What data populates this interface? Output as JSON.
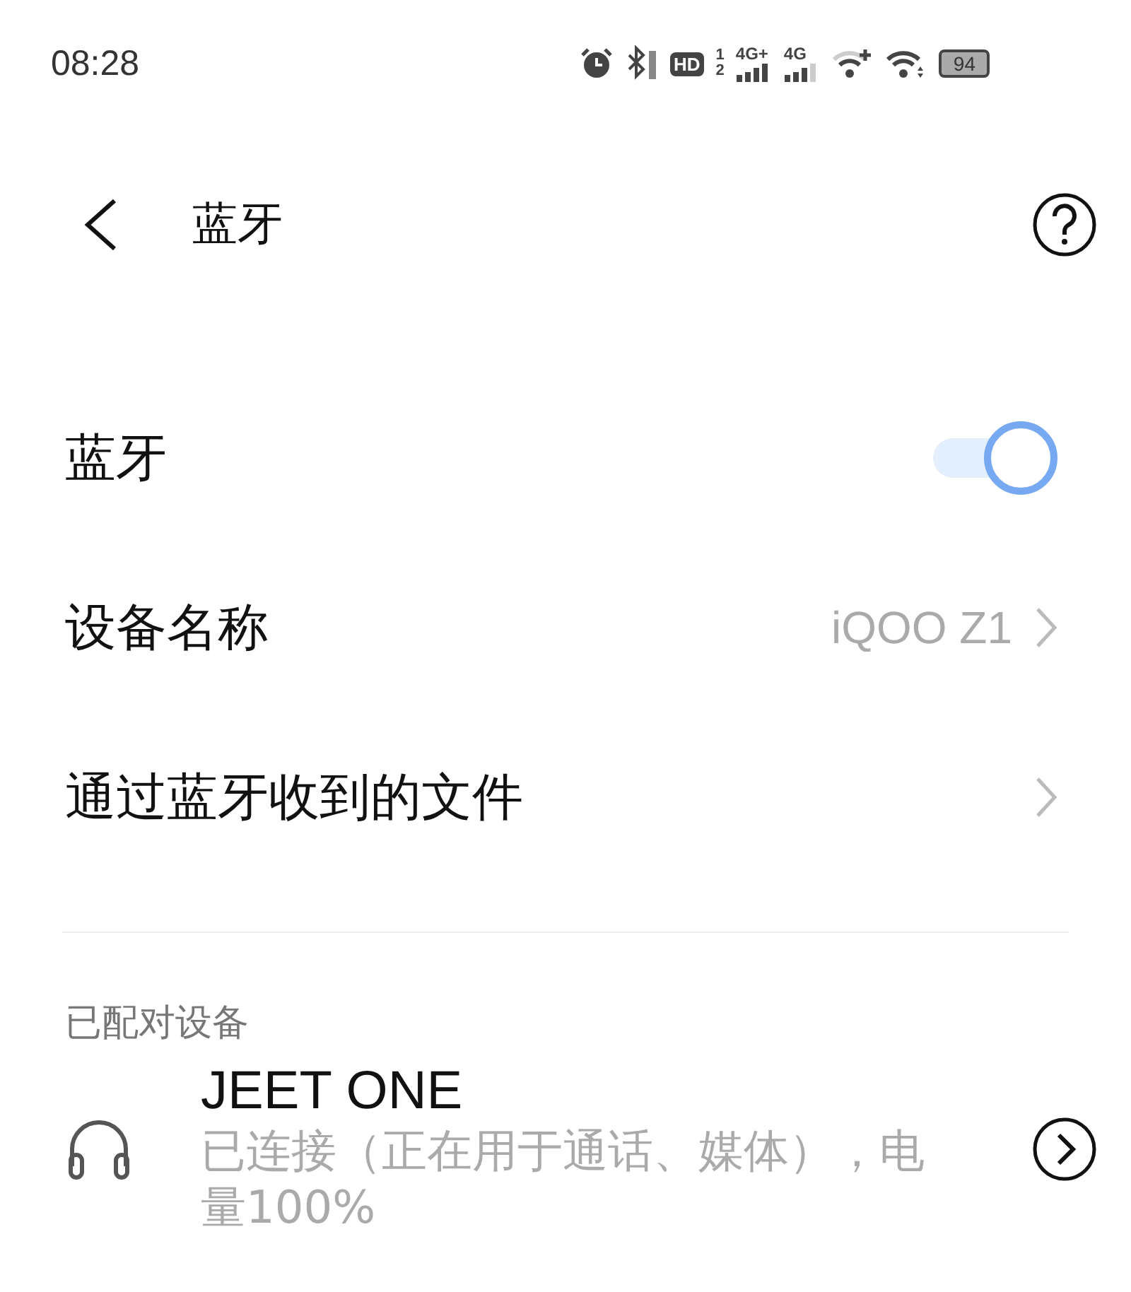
{
  "status_bar": {
    "time": "08:28",
    "hd_label": "HD",
    "sim_numbers": [
      "1",
      "2"
    ],
    "networks": [
      {
        "label": "4G+"
      },
      {
        "label": "4G"
      }
    ],
    "battery": "94"
  },
  "header": {
    "title": "蓝牙"
  },
  "settings": [
    {
      "kind": "toggle",
      "label": "蓝牙",
      "on": true
    },
    {
      "kind": "link",
      "label": "设备名称",
      "value": "iQOO Z1"
    },
    {
      "kind": "link",
      "label": "通过蓝牙收到的文件"
    }
  ],
  "paired": {
    "heading": "已配对设备",
    "devices": [
      {
        "name": "JEET ONE",
        "status": "已连接（正在用于通话、媒体），电量100%"
      }
    ]
  }
}
